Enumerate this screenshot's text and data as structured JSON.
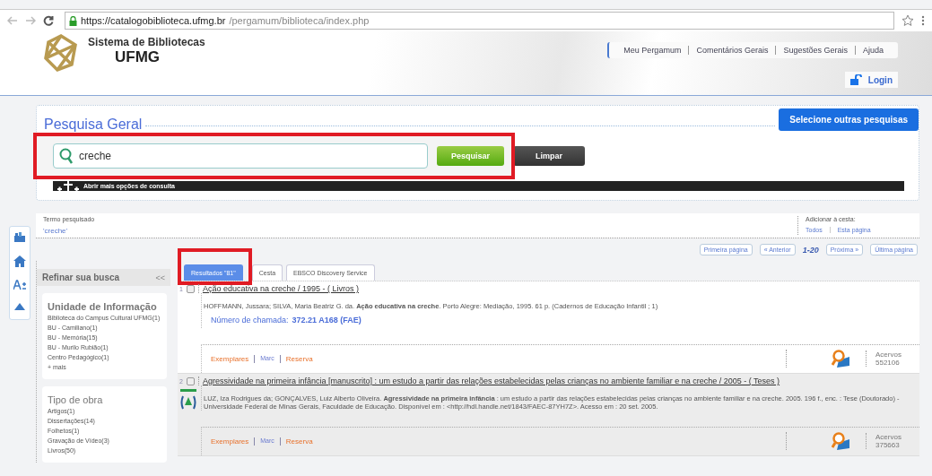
{
  "browser": {
    "url_host": "https://catalogobiblioteca.ufmg.br",
    "url_path": "/pergamum/biblioteca/index.php"
  },
  "header": {
    "subtitle": "Sistema de Bibliotecas",
    "title": "UFMG",
    "links": [
      "Meu Pergamum",
      "Comentários Gerais",
      "Sugestões Gerais",
      "Ajuda"
    ],
    "login": "Login"
  },
  "search": {
    "title": "Pesquisa Geral",
    "other_searches": "Selecione outras pesquisas",
    "value": "creche",
    "submit": "Pesquisar",
    "clear": "Limpar",
    "more_options": "Abrir mais opções de consulta",
    "highlighted": true
  },
  "term": {
    "label": "Termo pesquisado",
    "value": "'creche'"
  },
  "basket": {
    "label": "Adicionar à cesta:",
    "options": [
      "Todos",
      "Esta página"
    ]
  },
  "pagination": {
    "first": "Primeira página",
    "prev": "« Anterior",
    "range": "1-20",
    "next": "Próxima »",
    "last": "Última página"
  },
  "sidebar": {
    "title": "Refinar sua busca",
    "collapse": "<<",
    "facets": [
      {
        "title": "Unidade de Informação",
        "items": [
          "Biblioteca do Campus Cultural UFMG(1)",
          "BU - Camiliano(1)",
          "BU - Memória(15)",
          "BU - Murilo Rubião(1)",
          "Centro Pedagógico(1)",
          "+ mais"
        ]
      },
      {
        "title": "Tipo de obra",
        "items": [
          "Artigos(1)",
          "Dissertações(14)",
          "Folhetos(1)",
          "Gravação de Vídeo(3)",
          "Livros(50)"
        ]
      }
    ]
  },
  "tabs": [
    {
      "label": "Resultados \"81\"",
      "selected": true,
      "highlighted": true
    },
    {
      "label": "Cesta",
      "selected": false,
      "highlighted": false
    },
    {
      "label": "EBSCO Discovery Service",
      "selected": false,
      "highlighted": false
    }
  ],
  "results": [
    {
      "number": "1",
      "checked": false,
      "title": "Ação educativa na creche / 1995 - ( Livros )",
      "reference": "HOFFMANN, Jussara; SILVA, Maria Beatriz G. da. **Ação educativa na creche**. Porto Alegre: Mediação, 1995. 61 p. (Cadernos de Educação Infantil ; 1)",
      "call_number_label": "Número de chamada:",
      "call_number": "372.21 A168 (FAE)",
      "online": false,
      "links": [
        "Exemplares",
        "Marc",
        "Reserva"
      ],
      "holdings_label": "Acervos",
      "holdings_id": "552106"
    },
    {
      "number": "2",
      "checked": false,
      "title": "Agressividade na primeira infância [manuscrito] : um estudo a partir das relações estabelecidas pelas crianças no ambiente familiar e na creche / 2005 - ( Teses )",
      "reference": "LUZ, Iza Rodrigues da; GONÇALVES, Luiz Alberto Oliveira. **Agressividade na primeira infância** : um estudo a partir das relações estabelecidas pelas crianças no ambiente familiar e na creche. 2005. 196 f., enc. : Tese (Doutorado) - Universidade Federal de Minas Gerais, Faculdade de Educação. Disponível em : <http://hdl.handle.net/1843/FAEC-87YH7Z>. Acesso em : 20 set. 2005.",
      "online": true,
      "links": [
        "Exemplares",
        "Marc",
        "Reserva"
      ],
      "holdings_label": "Acervos",
      "holdings_id": "375663"
    }
  ]
}
